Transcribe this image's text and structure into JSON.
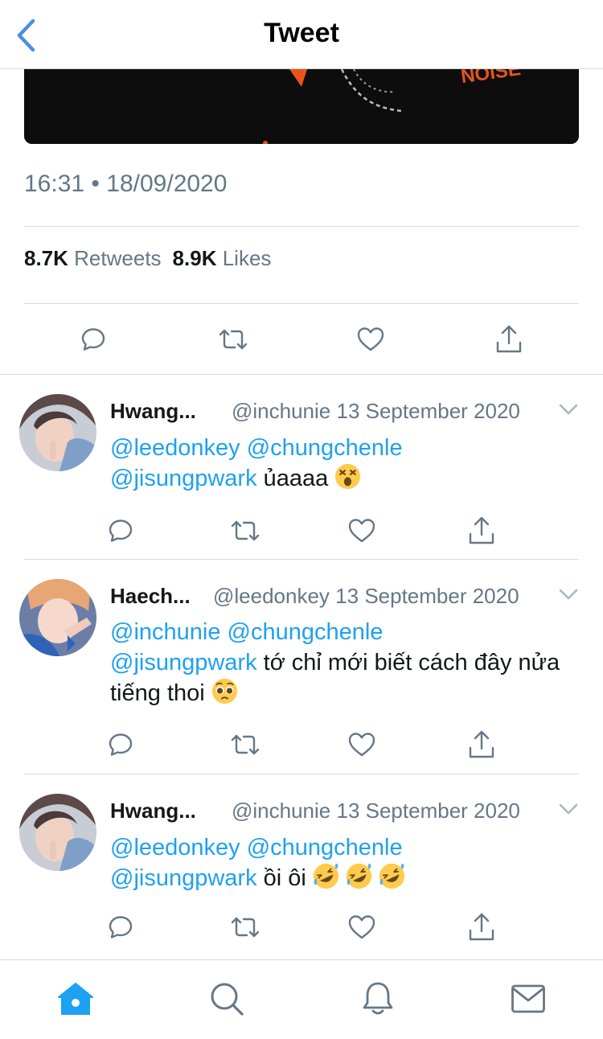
{
  "header": {
    "title": "Tweet"
  },
  "tweet": {
    "time": "16:31",
    "separator": "•",
    "date": "18/09/2020",
    "retweets_count": "8.7K",
    "retweets_label": "Retweets",
    "likes_count": "8.9K",
    "likes_label": "Likes"
  },
  "replies": [
    {
      "name": "Hwang...",
      "handle": "@inchunie",
      "date": "13 September 2020",
      "mentions_line1": "@leedonkey @chungchenle",
      "mention_line2": "@jisungpwark",
      "text": " ủaaaa ",
      "emoji": "astonished-face"
    },
    {
      "name": "Haech...",
      "handle": "@leedonkey",
      "date": "13 September 2020",
      "mentions_line1": "@inchunie @chungchenle",
      "mention_line2": "@jisungpwark",
      "text": " tớ chỉ mới biết cách đây nửa tiếng thoi ",
      "emoji": "pleading-face"
    },
    {
      "name": "Hwang...",
      "handle": "@inchunie",
      "date": "13 September 2020",
      "mentions_line1": "@leedonkey @chungchenle",
      "mention_line2": "@jisungpwark",
      "text": " ồi ôi ",
      "emoji": "rolling-on-floor-laughing x3"
    }
  ],
  "tabbar": [
    "home-icon",
    "search-icon",
    "notifications-icon",
    "messages-icon"
  ],
  "colors": {
    "accent": "#1da1f2",
    "muted": "#657786",
    "text": "#14171a",
    "divider": "#d6dbe0",
    "back": "#4a90e2"
  }
}
